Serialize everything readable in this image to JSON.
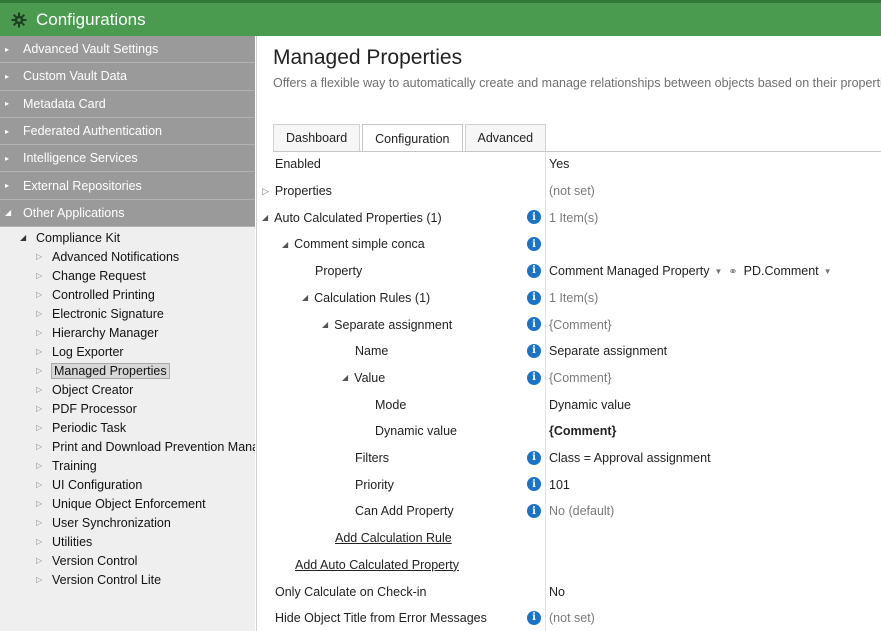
{
  "app": {
    "title": "Configurations",
    "accent": "#4a9a50",
    "icon": "gear-icon"
  },
  "sidebar": {
    "groups": [
      {
        "label": "Advanced Vault Settings"
      },
      {
        "label": "Custom Vault Data"
      },
      {
        "label": "Metadata Card"
      },
      {
        "label": "Federated Authentication"
      },
      {
        "label": "Intelligence Services"
      },
      {
        "label": "External Repositories"
      },
      {
        "label": "Other Applications"
      }
    ],
    "compliance_kit": "Compliance Kit",
    "items": [
      {
        "label": "Advanced Notifications"
      },
      {
        "label": "Change Request"
      },
      {
        "label": "Controlled Printing"
      },
      {
        "label": "Electronic Signature"
      },
      {
        "label": "Hierarchy Manager"
      },
      {
        "label": "Log Exporter"
      },
      {
        "label": "Managed Properties"
      },
      {
        "label": "Object Creator"
      },
      {
        "label": "PDF Processor"
      },
      {
        "label": "Periodic Task"
      },
      {
        "label": "Print and Download Prevention Mana"
      },
      {
        "label": "Training"
      },
      {
        "label": "UI Configuration"
      },
      {
        "label": "Unique Object Enforcement"
      },
      {
        "label": "User Synchronization"
      },
      {
        "label": "Utilities"
      },
      {
        "label": "Version Control"
      },
      {
        "label": "Version Control Lite"
      }
    ],
    "selected": "Managed Properties"
  },
  "main": {
    "title": "Managed Properties",
    "subtitle": "Offers a flexible way to automatically create and manage relationships between objects based on their properties.",
    "tabs": [
      {
        "label": "Dashboard"
      },
      {
        "label": "Configuration"
      },
      {
        "label": "Advanced"
      }
    ],
    "active_tab": "Configuration",
    "rows": [
      {
        "name": "Enabled",
        "value": "Yes"
      },
      {
        "name": "Properties",
        "value": "(not set)"
      },
      {
        "name": "Auto Calculated Properties (1)",
        "value": "1 Item(s)"
      },
      {
        "name": "Comment simple conca",
        "value": ""
      },
      {
        "name": "Property",
        "value": "Comment Managed Property",
        "value2": "PD.Comment"
      },
      {
        "name": "Calculation Rules (1)",
        "value": "1 Item(s)"
      },
      {
        "name": "Separate assignment",
        "value": "{Comment}"
      },
      {
        "name": "Name",
        "value": "Separate assignment"
      },
      {
        "name": "Value",
        "value": "{Comment}"
      },
      {
        "name": "Mode",
        "value": "Dynamic value"
      },
      {
        "name": "Dynamic value",
        "value": "{Comment}"
      },
      {
        "name": "Filters",
        "value": "Class  =  Approval assignment"
      },
      {
        "name": "Priority",
        "value": "101"
      },
      {
        "name": "Can Add Property",
        "value": "No (default)"
      },
      {
        "name": "Add Calculation Rule",
        "value": ""
      },
      {
        "name": "Add Auto Calculated Property",
        "value": ""
      },
      {
        "name": "Only Calculate on Check-in",
        "value": "No"
      },
      {
        "name": "Hide Object Title from Error Messages",
        "value": "(not set)"
      }
    ]
  }
}
